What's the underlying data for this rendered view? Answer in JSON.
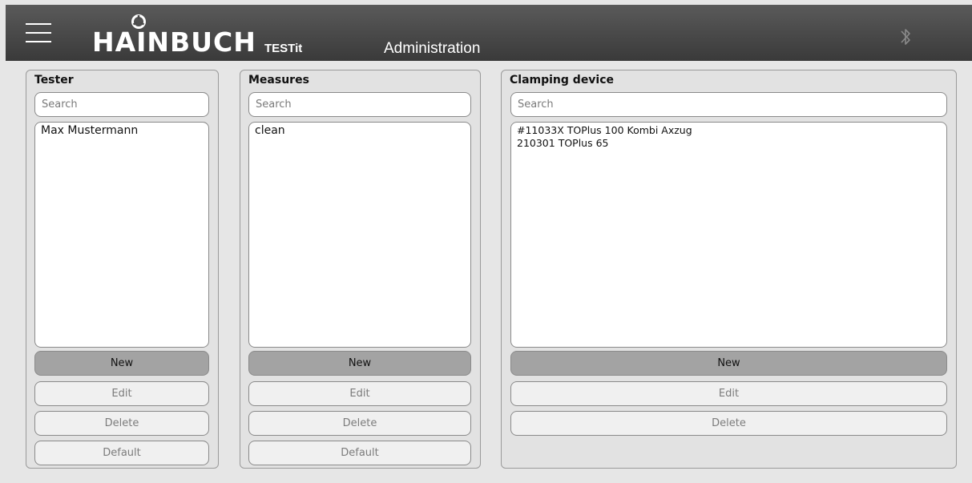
{
  "header": {
    "brand": "HAINBUCH",
    "app_name": "TESTit",
    "page_title": "Administration",
    "icons": [
      "menu-icon",
      "hainbuch-logo-icon",
      "bluetooth-icon"
    ]
  },
  "panels": {
    "tester": {
      "title": "Tester",
      "search_placeholder": "Search",
      "items": [
        "Max Mustermann"
      ],
      "buttons": {
        "new": "New",
        "edit": "Edit",
        "delete": "Delete",
        "default": "Default"
      }
    },
    "measures": {
      "title": "Measures",
      "search_placeholder": "Search",
      "items": [
        "clean"
      ],
      "buttons": {
        "new": "New",
        "edit": "Edit",
        "delete": "Delete",
        "default": "Default"
      }
    },
    "clamping": {
      "title": "Clamping device",
      "search_placeholder": "Search",
      "items": [
        "#11033X TOPlus 100 Kombi Axzug",
        "210301 TOPlus 65"
      ],
      "buttons": {
        "new": "New",
        "edit": "Edit",
        "delete": "Delete"
      }
    }
  },
  "colors": {
    "header_bg": "#3f3f3f",
    "panel_bg": "#e2e2e2",
    "new_button_bg": "#a3a3a3",
    "disabled_button_bg": "#f0f0f0"
  }
}
